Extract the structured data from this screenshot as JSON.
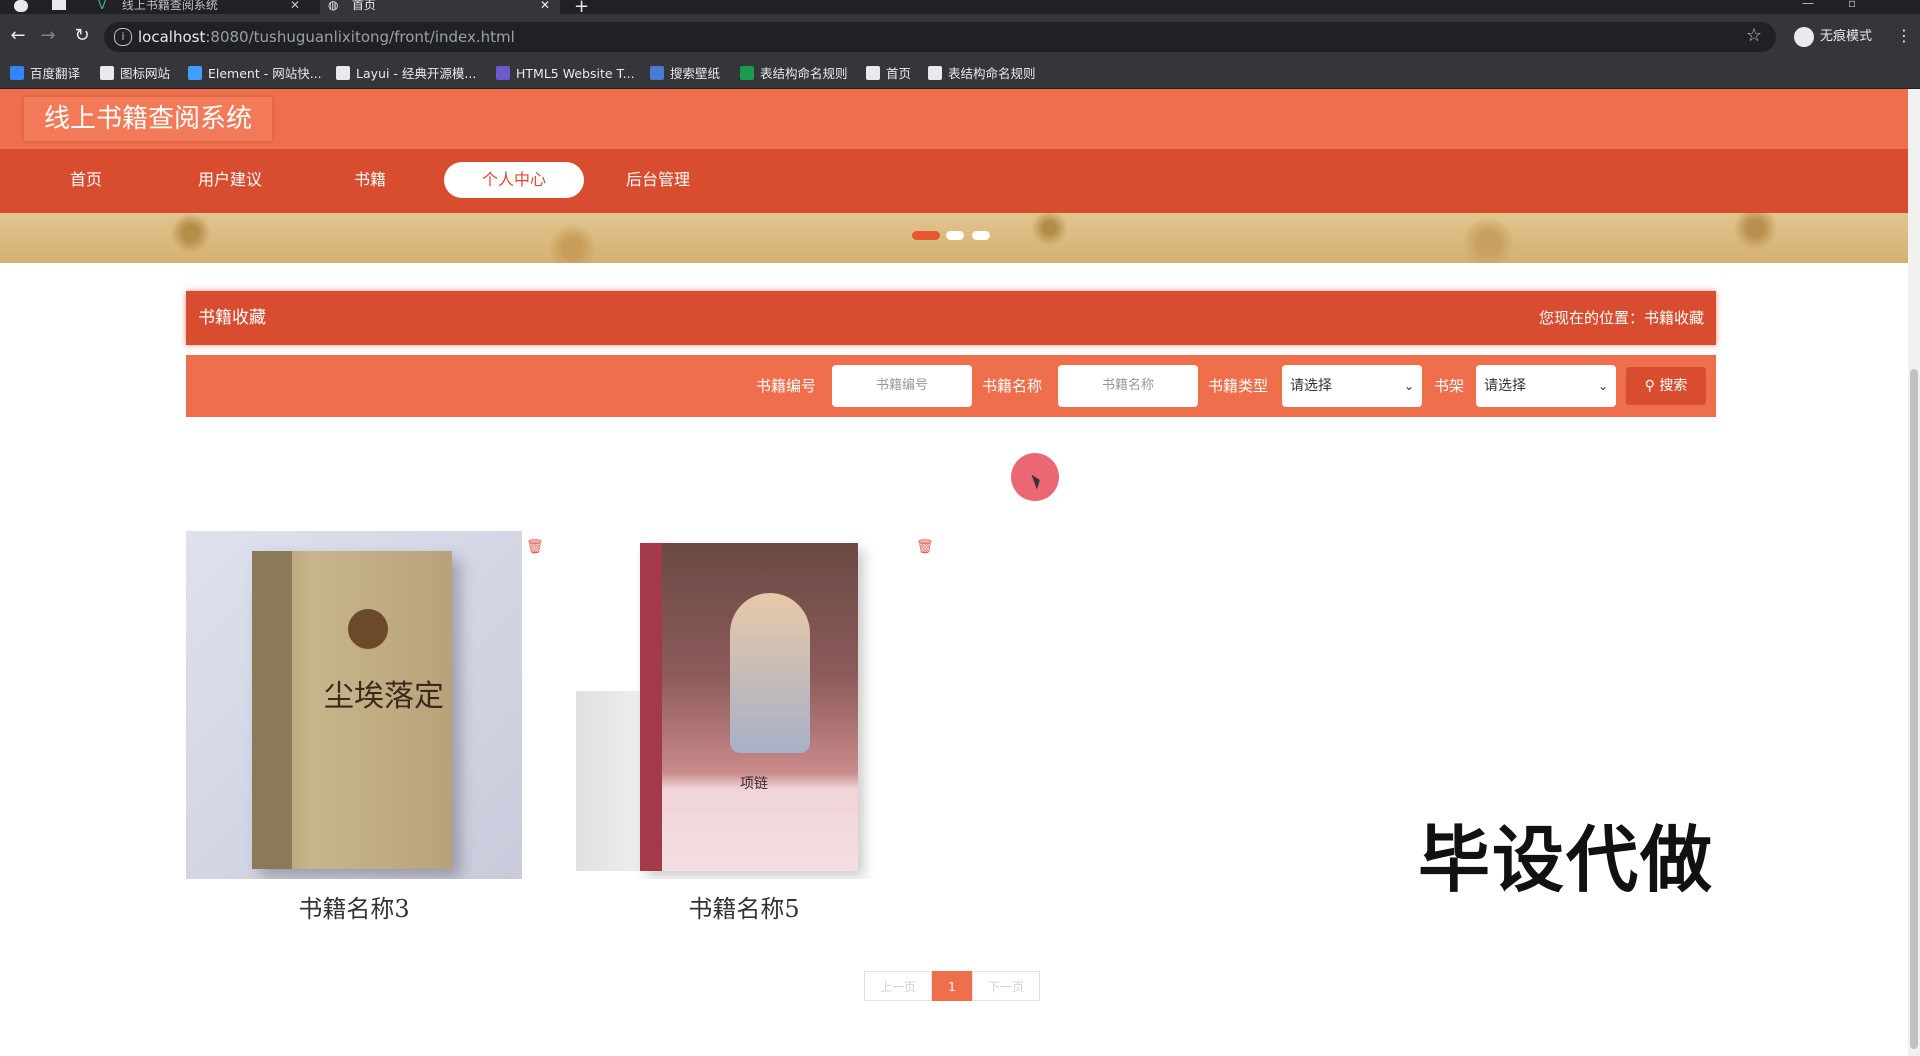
{
  "browser": {
    "tabs": [
      {
        "title": "线上书籍查阅系统"
      },
      {
        "title": "首页"
      }
    ],
    "url_host": "localhost",
    "url_path": ":8080/tushuguanlixitong/front/index.html",
    "incognito_label": "无痕模式",
    "bookmarks": [
      {
        "label": "百度翻译",
        "icon": "translate-icon",
        "color": "#3385ff"
      },
      {
        "label": "图标网站",
        "icon": "flag-icon",
        "color": "#e8eaed"
      },
      {
        "label": "Element - 网站快...",
        "icon": "element-icon",
        "color": "#409eff"
      },
      {
        "label": "Layui - 经典开源模...",
        "icon": "layui-icon",
        "color": "#e8eaed"
      },
      {
        "label": "HTML5 Website T...",
        "icon": "html5-icon",
        "color": "#6a5acd"
      },
      {
        "label": "搜索壁纸",
        "icon": "wallpaper-icon",
        "color": "#4a7bd8"
      },
      {
        "label": "表结构命名规则",
        "icon": "sheet-icon",
        "color": "#1a9a50"
      },
      {
        "label": "首页",
        "icon": "globe-icon",
        "color": "#e8eaed"
      },
      {
        "label": "表结构命名规则",
        "icon": "globe-icon",
        "color": "#e8eaed"
      }
    ]
  },
  "site": {
    "logo": "线上书籍查阅系统",
    "nav": [
      {
        "label": "首页"
      },
      {
        "label": "用户建议"
      },
      {
        "label": "书籍"
      },
      {
        "label": "个人中心"
      },
      {
        "label": "后台管理"
      }
    ],
    "active_nav": "个人中心"
  },
  "section": {
    "title": "书籍收藏",
    "location": "您现在的位置：书籍收藏"
  },
  "search": {
    "fields": [
      {
        "label": "书籍编号",
        "placeholder": "书籍编号"
      },
      {
        "label": "书籍名称",
        "placeholder": "书籍名称"
      }
    ],
    "type_label": "书籍类型",
    "type_value": "请选择",
    "shelf_label": "书架",
    "shelf_value": "请选择",
    "button": "搜索"
  },
  "books": [
    {
      "name": "书籍名称3",
      "cover_title": "尘埃落定"
    },
    {
      "name": "书籍名称5",
      "cover_title": "项链"
    }
  ],
  "pager": {
    "prev": "上一页",
    "current": "1",
    "next": "下一页"
  },
  "watermark": "毕设代做",
  "colors": {
    "header": "#ef6e4c",
    "nav": "#d84d30",
    "accent": "#d84d30"
  }
}
